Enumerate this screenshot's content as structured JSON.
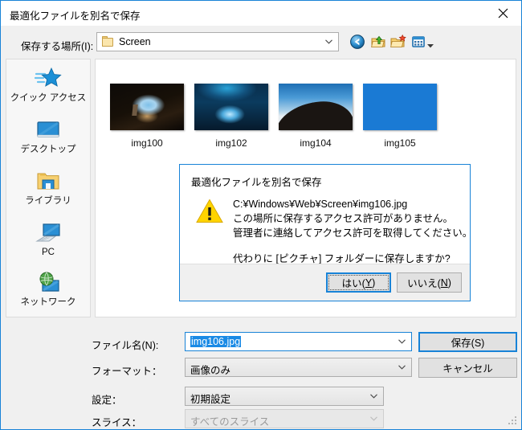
{
  "window": {
    "title": "最適化ファイルを別名で保存",
    "close_icon": "close-icon",
    "accent_color": "#1883d7"
  },
  "location": {
    "label": "保存する場所(I):",
    "value": "Screen",
    "folder_icon": "folder-icon",
    "dropdown_icon": "chevron-down-icon"
  },
  "toolbar": {
    "back": "back-icon",
    "up": "up-one-level-icon",
    "new_folder": "new-folder-icon",
    "views": "view-options-icon",
    "views_caret": "chevron-down-icon"
  },
  "places": [
    {
      "label": "クイック アクセス",
      "icon": "quick-access-star-icon"
    },
    {
      "label": "デスクトップ",
      "icon": "desktop-monitor-icon"
    },
    {
      "label": "ライブラリ",
      "icon": "library-folder-icon"
    },
    {
      "label": "PC",
      "icon": "this-pc-icon"
    },
    {
      "label": "ネットワーク",
      "icon": "network-globe-icon"
    }
  ],
  "files": [
    {
      "label": "img100",
      "art": "art-cave"
    },
    {
      "label": "img102",
      "art": "art-ice"
    },
    {
      "label": "img104",
      "art": "art-hill"
    },
    {
      "label": "img105",
      "art": "art-solid"
    }
  ],
  "dialog": {
    "title": "最適化ファイルを別名で保存",
    "warning_icon": "warning-triangle-icon",
    "line1": "C:¥Windows¥Web¥Screen¥img106.jpg",
    "line2": "この場所に保存するアクセス許可がありません。",
    "line3": "管理者に連絡してアクセス許可を取得してください。",
    "question": "代わりに [ピクチャ] フォルダーに保存しますか?",
    "yes_label": "はい(Y)",
    "yes_text": "はい(",
    "yes_key": "Y",
    "yes_tail": ")",
    "no_label": "いいえ(N)",
    "no_text": "いいえ(",
    "no_key": "N",
    "no_tail": ")"
  },
  "form": {
    "filename_label": "ファイル名(N):",
    "filename_value": "img106.jpg",
    "format_label": "フォーマット：",
    "format_value": "画像のみ",
    "settings_label": "設定：",
    "settings_value": "初期設定",
    "slices_label": "スライス：",
    "slices_value": "すべてのスライス",
    "save_label": "保存(S)",
    "cancel_label": "キャンセル",
    "dropdown_icon": "chevron-down-icon"
  }
}
